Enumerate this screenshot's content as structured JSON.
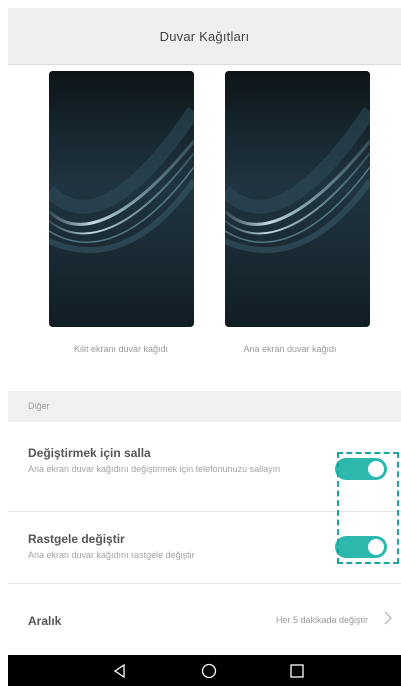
{
  "header": {
    "title": "Duvar Kağıtları"
  },
  "previews": {
    "lock_label": "Kilit ekranı duvar kağıdı",
    "home_label": "Ana ekran duvar kağıdı"
  },
  "section": {
    "title": "Diğer"
  },
  "settings": {
    "shake": {
      "title": "Değiştirmek için salla",
      "subtitle": "Ana ekran duvar kağıdını değiştirmek için telefonunuzu sallayın",
      "enabled": true
    },
    "random": {
      "title": "Rastgele değiştir",
      "subtitle": "Ana ekran duvar kağıdını rastgele değiştir",
      "enabled": true
    },
    "interval": {
      "title": "Aralık",
      "value": "Her 5 dakikada değiştir"
    }
  },
  "colors": {
    "accent": "#2db8ae",
    "highlight": "#1aa6a0",
    "header_bg": "#efefef"
  },
  "navbar": {
    "icons": [
      "back-icon",
      "home-icon",
      "recents-icon"
    ]
  }
}
